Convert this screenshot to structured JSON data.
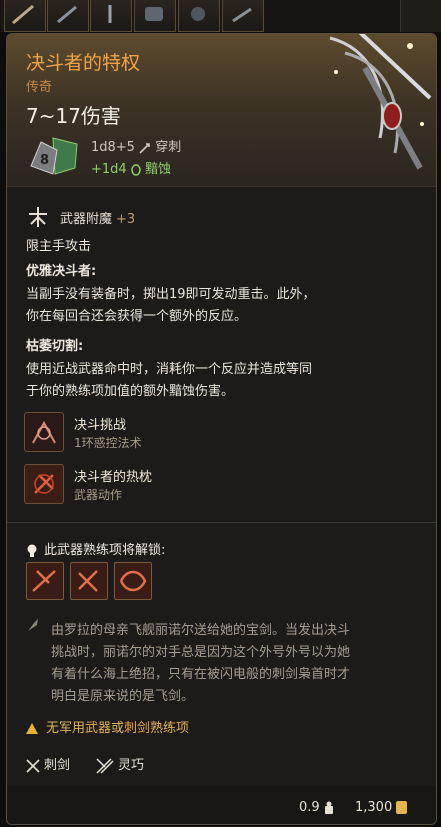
{
  "item": {
    "name": "决斗者的特权",
    "rarity": "传奇",
    "damage_summary": "7~17伤害",
    "die_face": "8",
    "damage_main": "1d8+5",
    "damage_main_type": "穿刺",
    "damage_bonus": "+1d4",
    "damage_bonus_type": "黯蚀"
  },
  "enchant": {
    "label": "武器附魔",
    "value": "+3"
  },
  "traits": {
    "offhand_only": "限主手攻击",
    "graceful_title": "优雅决斗者:",
    "graceful_line1": "当副手没有装备时，掷出19即可发动重击。此外，",
    "graceful_line2": "你在每回合还会获得一个额外的反应。",
    "wither_title": "枯萎切割:",
    "wither_line1": "使用近战武器命中时，消耗你一个反应并造成等同",
    "wither_line2": "于你的熟练项加值的额外黯蚀伤害。"
  },
  "actions": [
    {
      "name": "决斗挑战",
      "sub": "1环惑控法术",
      "icon": "duel-challenge-icon"
    },
    {
      "name": "决斗者的热枕",
      "sub": "武器动作",
      "icon": "duellist-zeal-icon"
    }
  ],
  "proficiency": {
    "heading": "此武器熟练项将解锁:"
  },
  "lore": {
    "line1": "由罗拉的母亲飞舰丽诺尔送给她的宝剑。当发出决斗",
    "line2": "挑战时，丽诺尔的对手总是因为这个外号外号以为她",
    "line3": "有着什么海上绝招，只有在被闪电般的刺剑枭首时才",
    "line4": "明白是原来说的是飞剑。"
  },
  "warning": {
    "pre": "无军用武器或",
    "highlight": "刺剑",
    "post": "熟练项"
  },
  "properties": [
    {
      "label": "刺剑"
    },
    {
      "label": "灵巧"
    }
  ],
  "footer": {
    "weight": "0.9",
    "price": "1,300"
  },
  "colors": {
    "title": "#f2a347",
    "rarity": "#c98a48",
    "bonus": "#8fd06a",
    "warning": "#e0b25a"
  }
}
